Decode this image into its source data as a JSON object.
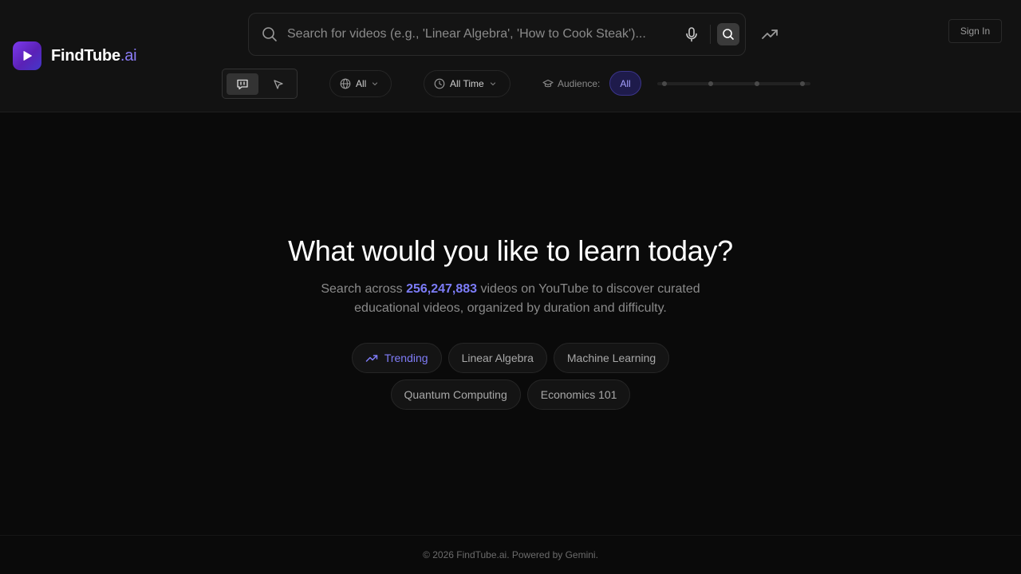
{
  "brand": {
    "name": "FindTube",
    "tld": ".ai"
  },
  "search": {
    "placeholder": "Search for videos (e.g., 'Linear Algebra', 'How to Cook Steak')...",
    "value": ""
  },
  "header": {
    "sign_in_label": "Sign In"
  },
  "filters": {
    "language_label": "All",
    "time_label": "All Time",
    "audience_label": "Audience:",
    "audience_value": "All",
    "audience_level": 0
  },
  "hero": {
    "title": "What would you like to learn today?",
    "sub_before": "Search across ",
    "video_count": "256,247,883",
    "sub_after": " videos on YouTube to discover curated educational videos, organized by duration and difficulty."
  },
  "chips": [
    {
      "label": "Trending",
      "icon": "trending-up-icon"
    },
    {
      "label": "Linear Algebra"
    },
    {
      "label": "Machine Learning"
    },
    {
      "label": "Quantum Computing"
    },
    {
      "label": "Economics 101"
    }
  ],
  "footer": {
    "text": "© 2026 FindTube.ai. Powered by Gemini."
  },
  "colors": {
    "accent": "#7c7cf8",
    "brand_gradient_start": "#7c3aed",
    "brand_gradient_end": "#4338ca",
    "background": "#0a0a0a"
  }
}
